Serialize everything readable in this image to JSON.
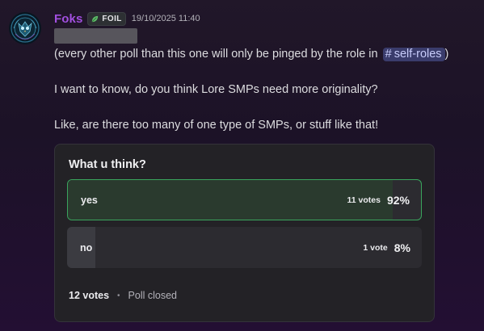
{
  "message": {
    "author": {
      "name": "Foks",
      "name_color": "#a24fe0",
      "avatar_icon": "owl-emblem-icon",
      "tag": {
        "icon": "leaf-icon",
        "label": "FOIL"
      }
    },
    "timestamp": "19/10/2025 11:40",
    "lines": {
      "line1_prefix": "(every other poll than this one will only be pinged by the role in",
      "line1_channel_hash": "#",
      "line1_channel_name": "self-roles",
      "line1_suffix": ")",
      "line2": "I want to know, do you think Lore SMPs need more originality?",
      "line3": "Like, are there too many of one type of SMPs, or stuff like that!"
    }
  },
  "poll": {
    "question": "What u think?",
    "answers": [
      {
        "label": "yes",
        "votes_text": "11 votes",
        "percent_text": "92%",
        "percent": 92,
        "winner": true
      },
      {
        "label": "no",
        "votes_text": "1 vote",
        "percent_text": "8%",
        "percent": 8,
        "winner": false
      }
    ],
    "total_votes": "12 votes",
    "separator": "•",
    "status": "Poll closed",
    "colors": {
      "winner_border": "#3aa55d",
      "card_background": "#232226"
    }
  }
}
